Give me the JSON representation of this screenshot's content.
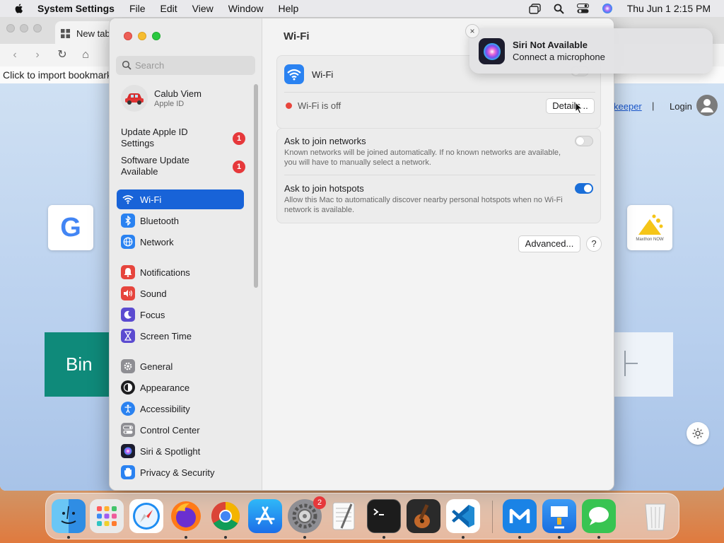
{
  "menubar": {
    "app_name": "System Settings",
    "menus": [
      "File",
      "Edit",
      "View",
      "Window",
      "Help"
    ],
    "clock": "Thu Jun 1  2:15 PM",
    "icons": [
      "apple-icon",
      "window-stack-icon",
      "search-icon",
      "control-center-icon",
      "siri-icon"
    ]
  },
  "browser": {
    "tab_title": "New tab",
    "bookmark_hint": "Click to import bookmarks",
    "keeper_link": "keeper",
    "separator": "|",
    "login_link": "Login",
    "bing_tile_text": "Bin",
    "maxthon_tile_text": "Maxthon NOW"
  },
  "settings": {
    "search_placeholder": "Search",
    "profile": {
      "name": "Calub Viem",
      "sub": "Apple ID"
    },
    "alerts": [
      {
        "label": "Update Apple ID Settings",
        "badge": "1"
      },
      {
        "label": "Software Update Available",
        "badge": "1"
      }
    ],
    "sidebar_items": [
      {
        "label": "Wi-Fi",
        "icon": "wifi-icon",
        "color": "#2a82f1",
        "active": true
      },
      {
        "label": "Bluetooth",
        "icon": "bluetooth-icon",
        "color": "#2a82f1"
      },
      {
        "label": "Network",
        "icon": "globe-icon",
        "color": "#2a82f1"
      },
      {
        "label": "Notifications",
        "icon": "bell-icon",
        "color": "#e6453d"
      },
      {
        "label": "Sound",
        "icon": "speaker-icon",
        "color": "#e6453d"
      },
      {
        "label": "Focus",
        "icon": "moon-icon",
        "color": "#5b4bd0"
      },
      {
        "label": "Screen Time",
        "icon": "hourglass-icon",
        "color": "#5b4bd0"
      },
      {
        "label": "General",
        "icon": "gear-icon",
        "color": "#8e8e93"
      },
      {
        "label": "Appearance",
        "icon": "appearance-icon",
        "color": "#1d1d1f"
      },
      {
        "label": "Accessibility",
        "icon": "accessibility-icon",
        "color": "#2a82f1"
      },
      {
        "label": "Control Center",
        "icon": "control-center-icon",
        "color": "#8e8e93"
      },
      {
        "label": "Siri & Spotlight",
        "icon": "siri-icon",
        "color": "#6a3fd0"
      },
      {
        "label": "Privacy & Security",
        "icon": "hand-icon",
        "color": "#2a82f1"
      }
    ],
    "content": {
      "title": "Wi-Fi",
      "wifi_label": "Wi-Fi",
      "wifi_enabled": false,
      "status_text": "Wi-Fi is off",
      "details_button": "Details...",
      "ask_networks_title": "Ask to join networks",
      "ask_networks_desc": "Known networks will be joined automatically. If no known networks are available, you will have to manually select a network.",
      "ask_networks_enabled": false,
      "ask_hotspots_title": "Ask to join hotspots",
      "ask_hotspots_desc": "Allow this Mac to automatically discover nearby personal hotspots when no Wi-Fi network is available.",
      "ask_hotspots_enabled": true,
      "advanced_button": "Advanced...",
      "help_button": "?"
    }
  },
  "notification": {
    "title": "Siri Not Available",
    "body": "Connect a microphone",
    "close": "×"
  },
  "dock": {
    "apps": [
      {
        "name": "Finder",
        "icon": "finder-icon"
      },
      {
        "name": "Launchpad",
        "icon": "launchpad-icon"
      },
      {
        "name": "Safari",
        "icon": "safari-icon"
      },
      {
        "name": "Firefox",
        "icon": "firefox-icon"
      },
      {
        "name": "Chrome",
        "icon": "chrome-icon"
      },
      {
        "name": "App Store",
        "icon": "app-store-icon"
      },
      {
        "name": "System Settings",
        "icon": "system-settings-icon",
        "badge": "2"
      },
      {
        "name": "TextEdit",
        "icon": "textedit-icon"
      },
      {
        "name": "Terminal",
        "icon": "terminal-icon"
      },
      {
        "name": "GarageBand",
        "icon": "garageband-icon"
      },
      {
        "name": "Visual Studio Code",
        "icon": "vscode-icon"
      },
      {
        "name": "Maxthon",
        "icon": "maxthon-icon"
      },
      {
        "name": "Keynote",
        "icon": "keynote-icon"
      },
      {
        "name": "Messages",
        "icon": "messages-icon"
      },
      {
        "name": "Trash",
        "icon": "trash-icon"
      }
    ]
  },
  "colors": {
    "accent": "#1863d8",
    "badge_red": "#e6383b",
    "wifi_off_dot": "#e8453c"
  }
}
